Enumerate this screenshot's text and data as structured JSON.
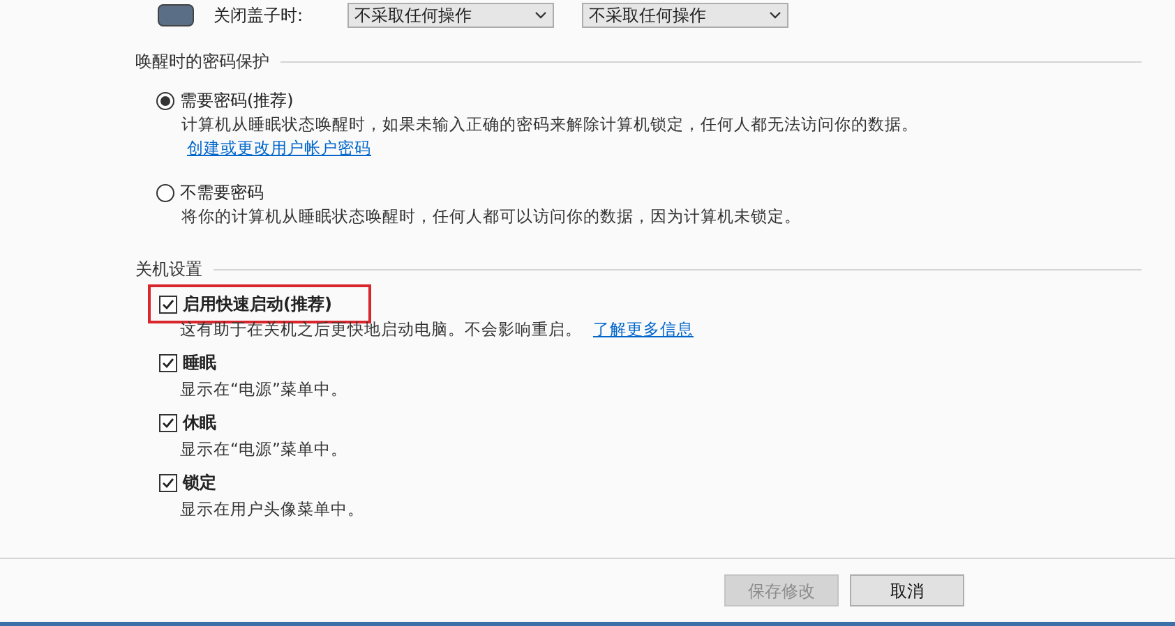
{
  "lid_row": {
    "label": "关闭盖子时:",
    "selects": [
      {
        "value": "不采取任何操作"
      },
      {
        "value": "不采取任何操作"
      }
    ]
  },
  "wake_password": {
    "heading": "唤醒时的密码保护",
    "options": [
      {
        "label": "需要密码(推荐)",
        "selected": true,
        "description": "计算机从睡眠状态唤醒时，如果未输入正确的密码来解除计算机锁定，任何人都无法访问你的数据。",
        "link": "创建或更改用户帐户密码"
      },
      {
        "label": "不需要密码",
        "selected": false,
        "description": "将你的计算机从睡眠状态唤醒时，任何人都可以访问你的数据，因为计算机未锁定。"
      }
    ]
  },
  "shutdown_settings": {
    "heading": "关机设置",
    "items": [
      {
        "label": "启用快速启动(推荐)",
        "checked": true,
        "highlighted": true,
        "description": "这有助于在关机之后更快地启动电脑。不会影响重启。",
        "link": "了解更多信息"
      },
      {
        "label": "睡眠",
        "checked": true,
        "highlighted": false,
        "description": "显示在“电源”菜单中。"
      },
      {
        "label": "休眠",
        "checked": true,
        "highlighted": false,
        "description": "显示在“电源”菜单中。"
      },
      {
        "label": "锁定",
        "checked": true,
        "highlighted": false,
        "description": "显示在用户头像菜单中。"
      }
    ]
  },
  "buttons": [
    {
      "label": "保存修改",
      "disabled": true
    },
    {
      "label": "取消",
      "disabled": false
    }
  ]
}
